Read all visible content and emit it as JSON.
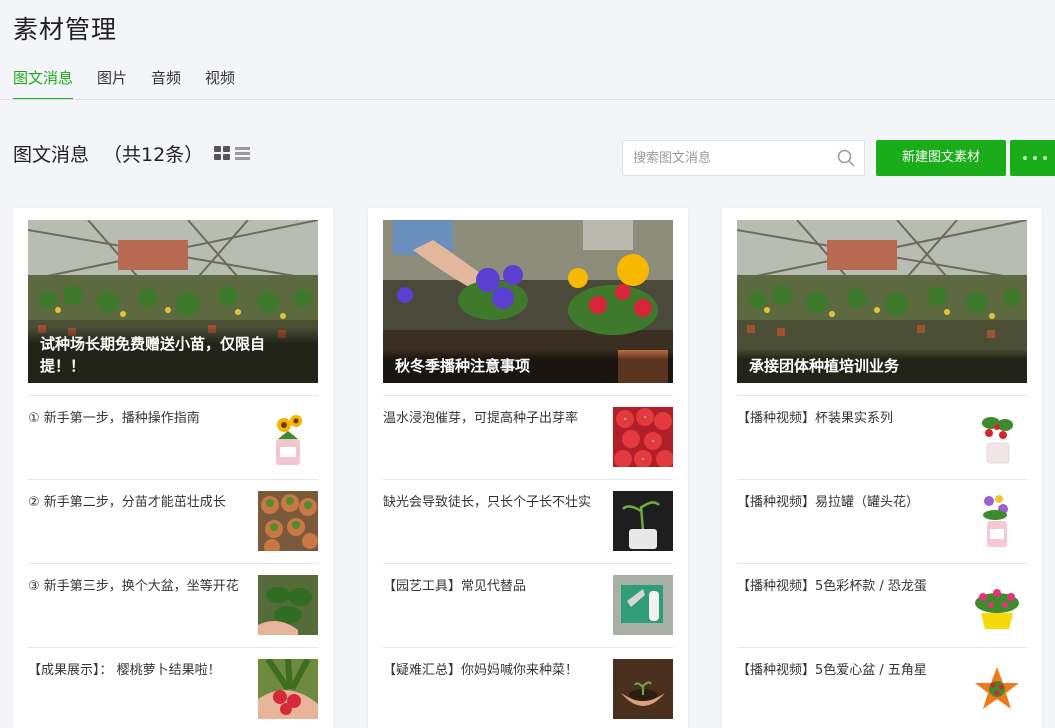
{
  "page": {
    "title": "素材管理"
  },
  "tabs": [
    {
      "label": "图文消息",
      "active": true
    },
    {
      "label": "图片",
      "active": false
    },
    {
      "label": "音频",
      "active": false
    },
    {
      "label": "视频",
      "active": false
    }
  ],
  "section": {
    "title": "图文消息",
    "count": "（共12条）"
  },
  "search": {
    "placeholder": "搜索图文消息"
  },
  "actions": {
    "new_label": "新建图文素材"
  },
  "colors": {
    "accent": "#1aad19",
    "background": "#f4f5f9"
  },
  "cards": [
    {
      "cover_title": "试种场长期免费赠送小苗，仅限自提！！",
      "cover_image": "greenhouse",
      "items": [
        {
          "text": "① 新手第一步，播种操作指南",
          "thumb": "sunflower-pot"
        },
        {
          "text": "② 新手第二步，分苗才能茁壮成长",
          "thumb": "seedling-pots"
        },
        {
          "text": "③ 新手第三步，换个大盆，坐等开花",
          "thumb": "seedling-hand"
        },
        {
          "text": "【成果展示】：  樱桃萝卜结果啦！",
          "thumb": "radish"
        }
      ]
    },
    {
      "cover_title": "秋冬季播种注意事项",
      "cover_image": "primrose-planting",
      "items": [
        {
          "text": "温水浸泡催芽，可提高种子出芽率",
          "thumb": "strawberries"
        },
        {
          "text": "缺光会导致徒长，只长个子长不壮实",
          "thumb": "sprout-cup"
        },
        {
          "text": "【园艺工具】常见代替品",
          "thumb": "garden-tools"
        },
        {
          "text": "【疑难汇总】你妈妈喊你来种菜！",
          "thumb": "soil-hands"
        }
      ]
    },
    {
      "cover_title": "承接团体种植培训业务",
      "cover_image": "greenhouse",
      "items": [
        {
          "text": "【播种视频】杯装果实系列",
          "thumb": "strawberry-cup"
        },
        {
          "text": "【播种视频】易拉罐（罐头花）",
          "thumb": "flower-can"
        },
        {
          "text": "【播种视频】5色彩杯款 / 恐龙蛋",
          "thumb": "yellow-pot"
        },
        {
          "text": "【播种视频】5色爱心盆 / 五角星",
          "thumb": "star-pot"
        }
      ]
    }
  ]
}
